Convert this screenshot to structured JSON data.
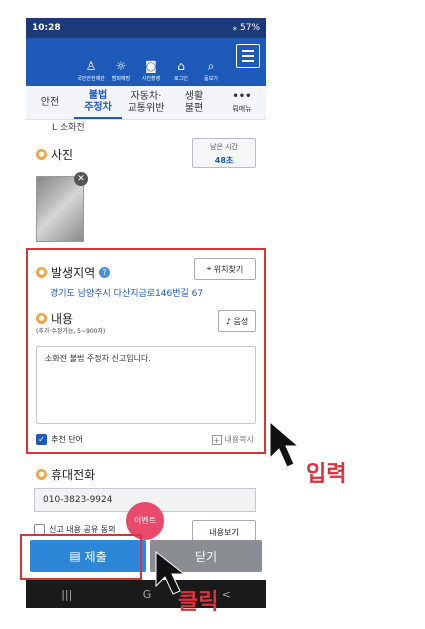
{
  "status": {
    "time": "10:28",
    "right": "⁎ 57%"
  },
  "top_nav": [
    {
      "label": "국민안전제안",
      "icon": "♙"
    },
    {
      "label": "범죄예방",
      "icon": "☼"
    },
    {
      "label": "사진촬영",
      "icon": "◙"
    },
    {
      "label": "로그인",
      "icon": "⌂"
    },
    {
      "label": "돋보기",
      "icon": "⌕"
    }
  ],
  "tabs": [
    {
      "line1": "안전",
      "line2": ""
    },
    {
      "line1": "불법",
      "line2": "주정차"
    },
    {
      "line1": "자동차·",
      "line2": "교통위반"
    },
    {
      "line1": "생활",
      "line2": "불편"
    },
    {
      "line1": "•••",
      "line2": "뤄메뉴"
    }
  ],
  "prev_item": "L 소화전",
  "photo": {
    "label": "사진",
    "time_label": "남은 시간",
    "time_value": "48초"
  },
  "location": {
    "label": "발생지역",
    "find_button": "위치찾기",
    "address": "경기도 남양주시 다산지금로146번길 67"
  },
  "content": {
    "label": "내용",
    "hint": "(추가·수정가능, 5~900자)",
    "voice_button": "음성",
    "text": "소화전 불법 주정차 신고입니다.",
    "recommend": "추천 단어",
    "copy": "내용복사"
  },
  "phone": {
    "label": "휴대전화",
    "value": "010-3823-9924"
  },
  "share": {
    "label": "신고 내용 공유 동의",
    "view_button": "내용보기"
  },
  "event_badge": "이벤트",
  "actions": {
    "submit": "제출",
    "close": "닫기"
  },
  "android_nav": [
    "|||",
    "G",
    "<"
  ],
  "annotations": {
    "input": "입력",
    "click": "클릭"
  },
  "colors": {
    "primary": "#1e5bb8",
    "highlight": "#d9333d",
    "submit": "#2c87d8",
    "close": "#8a8d92"
  }
}
